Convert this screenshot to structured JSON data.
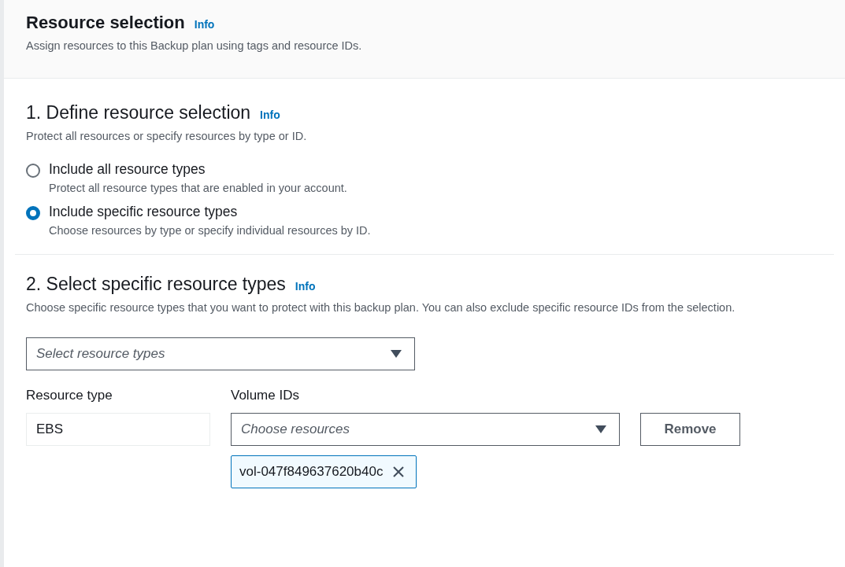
{
  "header": {
    "title": "Resource selection",
    "info": "Info",
    "description": "Assign resources to this Backup plan using tags and resource IDs."
  },
  "step1": {
    "title": "1. Define resource selection",
    "info": "Info",
    "description": "Protect all resources or specify resources by type or ID.",
    "options": [
      {
        "label": "Include all resource types",
        "description": "Protect all resource types that are enabled in your account.",
        "selected": false
      },
      {
        "label": "Include specific resource types",
        "description": "Choose resources by type or specify individual resources by ID.",
        "selected": true
      }
    ]
  },
  "step2": {
    "title": "2. Select specific resource types",
    "info": "Info",
    "description": "Choose specific resource types that you want to protect with this backup plan. You can also exclude specific resource IDs from the selection.",
    "type_select": {
      "placeholder": "Select resource types"
    },
    "rows": [
      {
        "type_label": "Resource type",
        "type_value": "EBS",
        "ids_label": "Volume IDs",
        "ids_placeholder": "Choose resources",
        "remove": "Remove",
        "tokens": [
          "vol-047f849637620b40c"
        ]
      }
    ]
  }
}
